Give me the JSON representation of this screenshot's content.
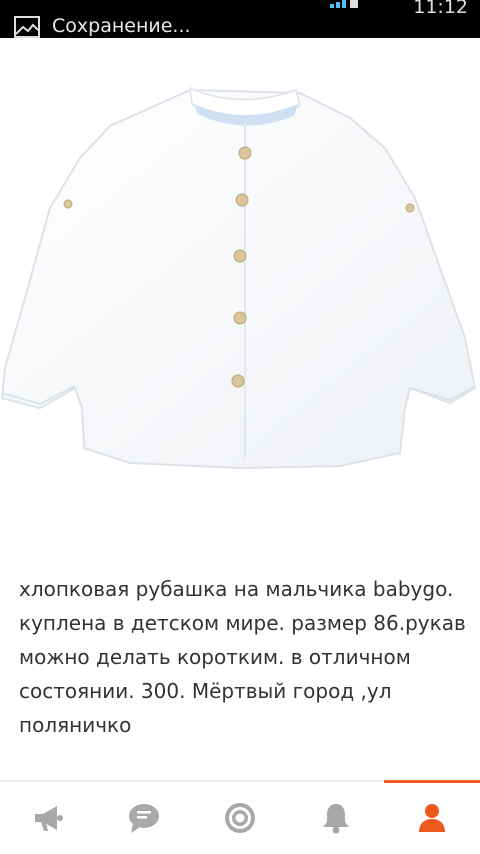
{
  "status_bar": {
    "text": "Сохранение...",
    "time": "11:12"
  },
  "product": {
    "image_alt": "white cotton boys shirt with band collar",
    "description": "хлопковая рубашка на мальчика babygo. куплена в детском мире. размер 86.рукав можно делать коротким. в отличном состоянии. 300. Мёртвый город ,ул поляничко"
  },
  "nav": {
    "items": [
      {
        "icon": "megaphone-icon"
      },
      {
        "icon": "chat-icon"
      },
      {
        "icon": "target-icon"
      },
      {
        "icon": "bell-icon"
      },
      {
        "icon": "profile-icon"
      }
    ],
    "active_index": 4
  },
  "colors": {
    "accent": "#ee5a1e",
    "nav_icon": "#a8a8a8",
    "text": "#333333"
  }
}
